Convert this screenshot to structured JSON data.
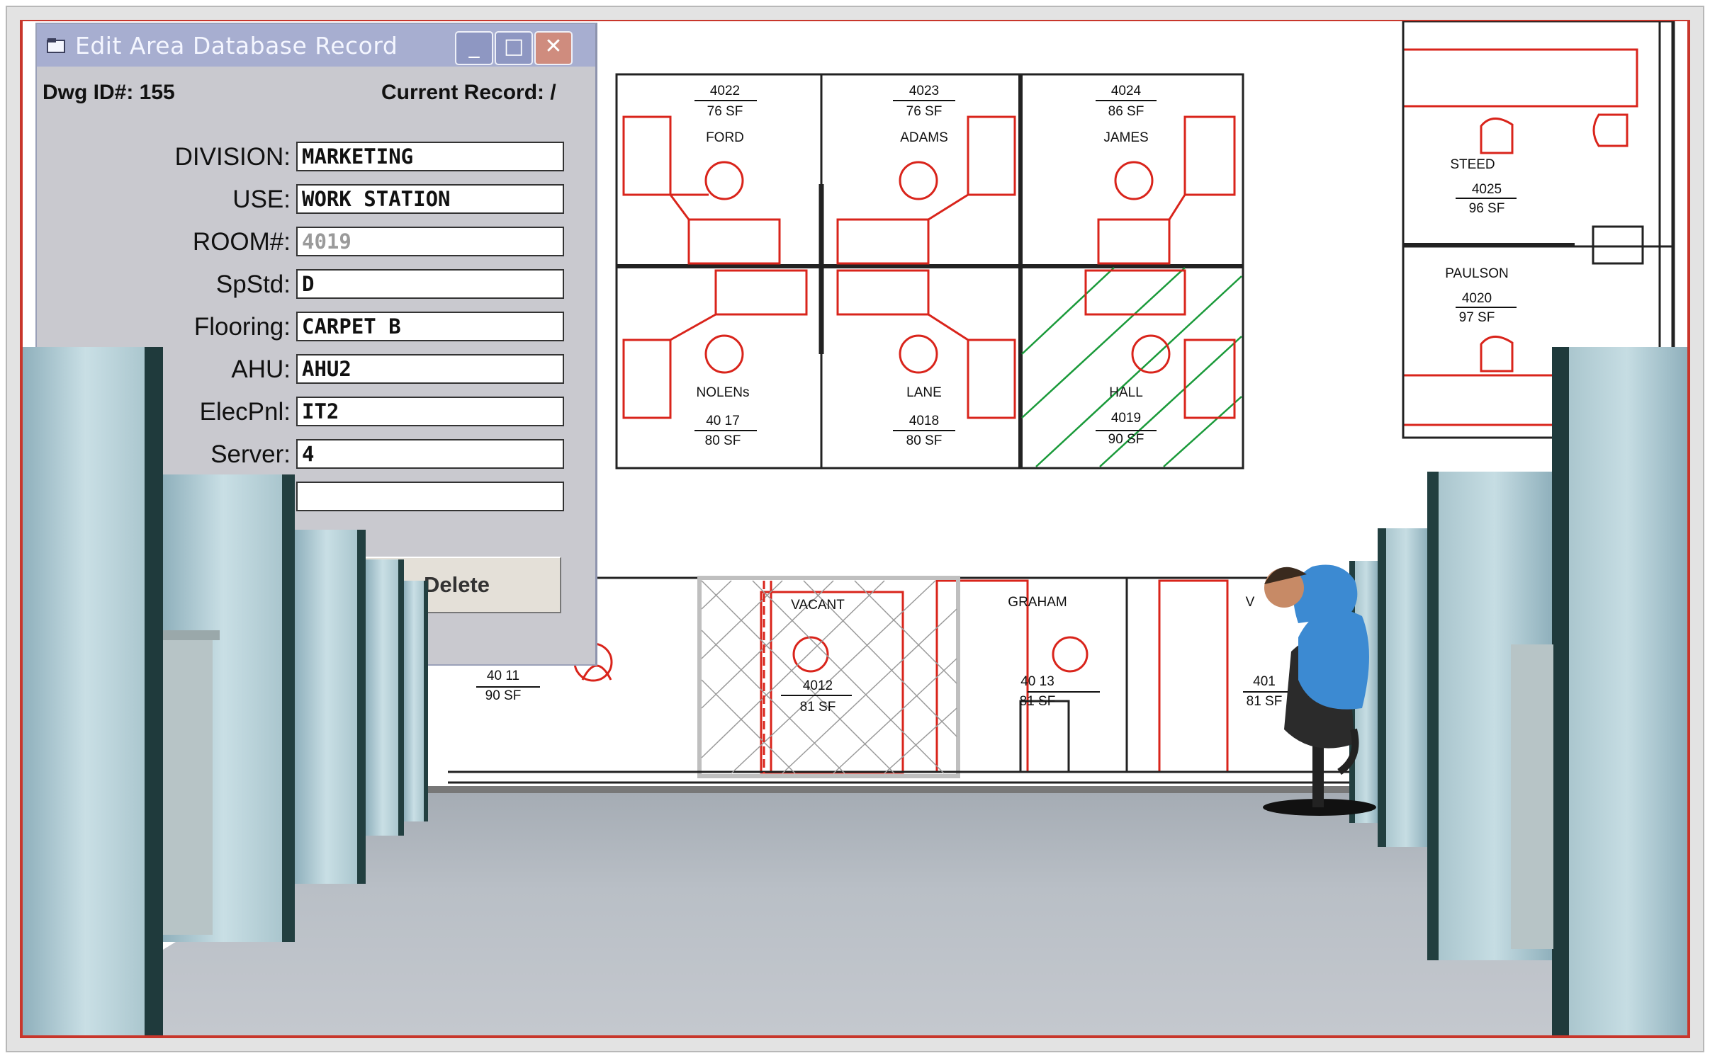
{
  "dialog": {
    "title": "Edit Area Database Record",
    "buttons": {
      "minimize": "_",
      "maximize": "□",
      "close": "✕"
    },
    "dwg_id": "Dwg ID#: 155",
    "current_record": "Current Record: /",
    "fields": [
      {
        "label": "DIVISION:",
        "value": "MARKETING"
      },
      {
        "label": "USE:",
        "value": "WORK STATION"
      },
      {
        "label": "ROOM#:",
        "value": "4019"
      },
      {
        "label": "SpStd:",
        "value": "D"
      },
      {
        "label": "Flooring:",
        "value": "CARPET B"
      },
      {
        "label": "AHU:",
        "value": "AHU2"
      },
      {
        "label": "ElecPnl:",
        "value": "IT2"
      },
      {
        "label": "Server:",
        "value": "4"
      },
      {
        "label": "",
        "value": ""
      }
    ],
    "delete_label": "Delete"
  },
  "floorplan": {
    "rooms": [
      {
        "name": "FORD",
        "number": "4022",
        "area": "76 SF"
      },
      {
        "name": "ADAMS",
        "number": "4023",
        "area": "76 SF"
      },
      {
        "name": "JAMES",
        "number": "4024",
        "area": "86 SF"
      },
      {
        "name": "NOLENs",
        "number": "40 17",
        "area": "80 SF"
      },
      {
        "name": "LANE",
        "number": "4018",
        "area": "80 SF"
      },
      {
        "name": "HALL",
        "number": "4019",
        "area": "90 SF"
      },
      {
        "name": "STEED",
        "number": "4025",
        "area": "96 SF"
      },
      {
        "name": "PAULSON",
        "number": "4020",
        "area": "97 SF"
      },
      {
        "name": "VACANT",
        "number": "4012",
        "area": "81 SF"
      },
      {
        "name": "GRAHAM",
        "number": "40 13",
        "area": "81 SF"
      },
      {
        "name": "",
        "number": "40 11",
        "area": "90 SF"
      },
      {
        "name": "V",
        "number": "401",
        "area": "81 SF"
      }
    ]
  },
  "colors": {
    "accent": "#d9241b",
    "hatch": "#1a9a3a",
    "frame": "#c8362b",
    "dialog": "#c9c9cf",
    "titlebar": "#a7aed0"
  }
}
